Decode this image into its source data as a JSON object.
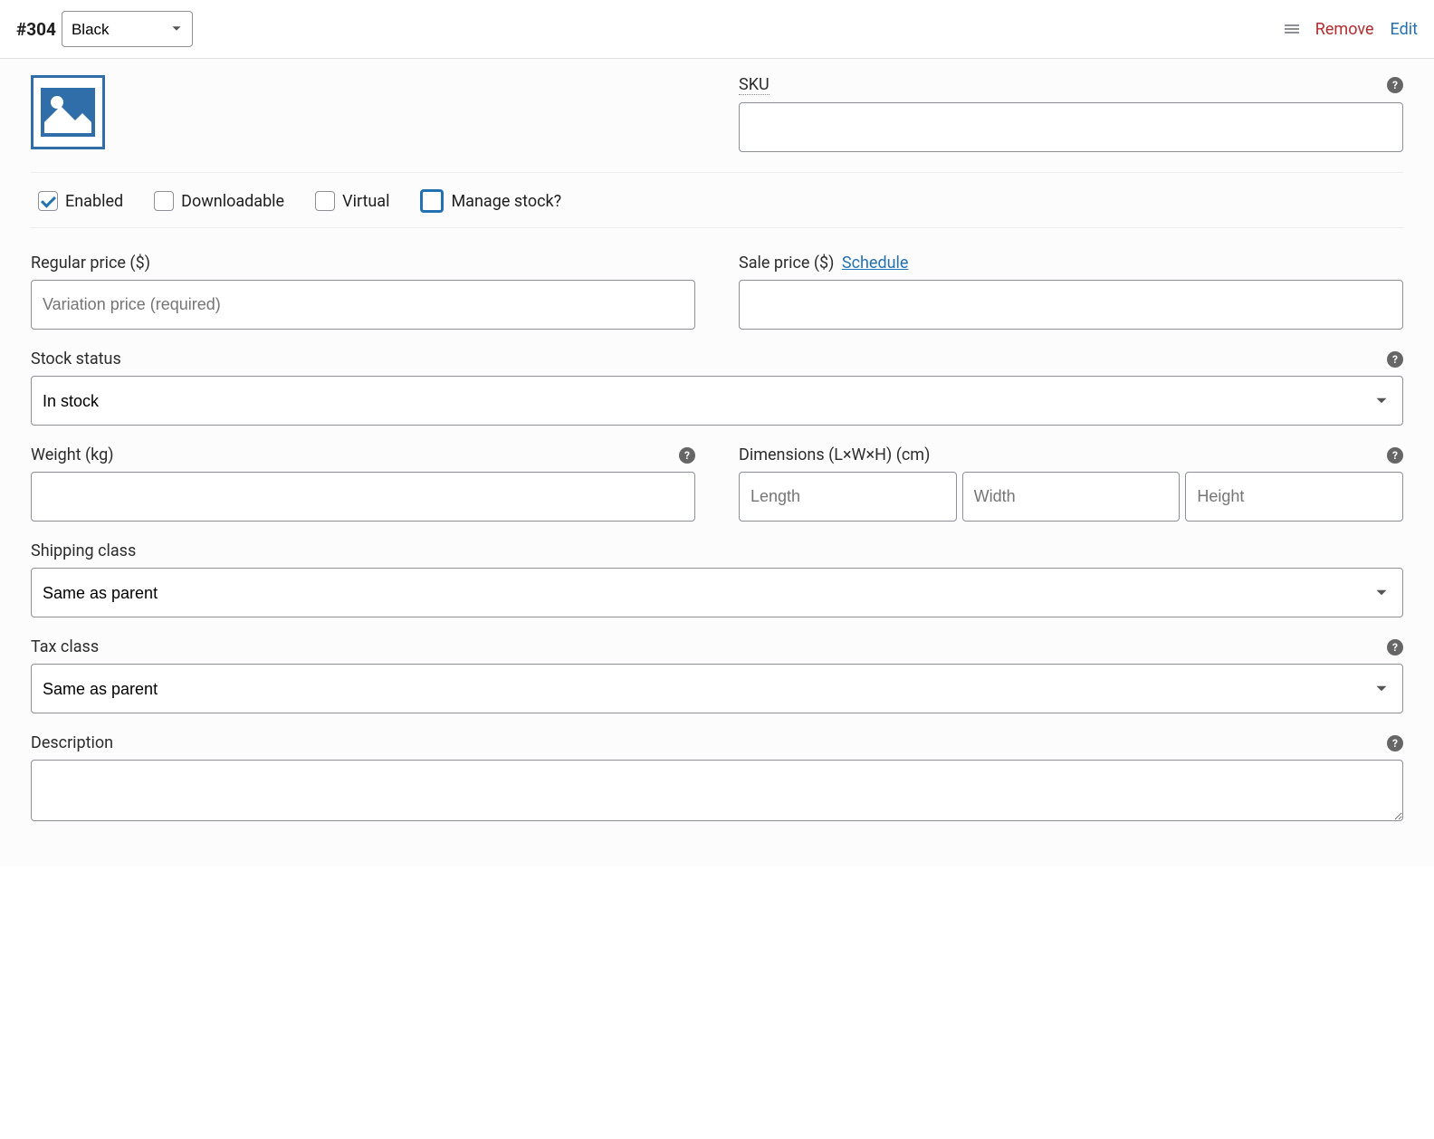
{
  "header": {
    "variation_id": "#304",
    "attribute_value": "Black",
    "remove_label": "Remove",
    "edit_label": "Edit"
  },
  "checkboxes": {
    "enabled_label": "Enabled",
    "downloadable_label": "Downloadable",
    "virtual_label": "Virtual",
    "manage_stock_label": "Manage stock?",
    "enabled_checked": true,
    "downloadable_checked": false,
    "virtual_checked": false,
    "manage_stock_checked": false
  },
  "fields": {
    "sku_label": "SKU",
    "sku_value": "",
    "regular_price_label": "Regular price ($)",
    "regular_price_placeholder": "Variation price (required)",
    "regular_price_value": "",
    "sale_price_label": "Sale price ($)",
    "schedule_label": "Schedule",
    "sale_price_value": "",
    "stock_status_label": "Stock status",
    "stock_status_value": "In stock",
    "weight_label": "Weight (kg)",
    "weight_value": "",
    "dimensions_label": "Dimensions (L×W×H) (cm)",
    "length_placeholder": "Length",
    "width_placeholder": "Width",
    "height_placeholder": "Height",
    "length_value": "",
    "width_value": "",
    "height_value": "",
    "shipping_class_label": "Shipping class",
    "shipping_class_value": "Same as parent",
    "tax_class_label": "Tax class",
    "tax_class_value": "Same as parent",
    "description_label": "Description",
    "description_value": ""
  },
  "help_char": "?"
}
